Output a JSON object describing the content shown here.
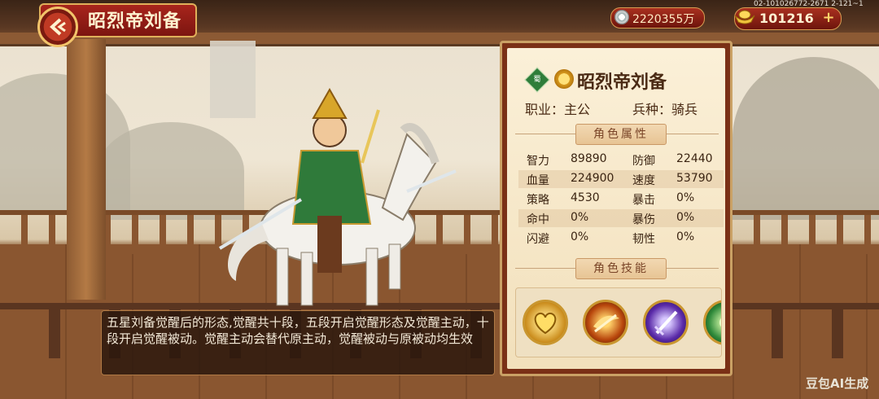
{
  "header": {
    "title": "昭烈帝刘备"
  },
  "currency": {
    "silver": "2220355万",
    "gold": "101216",
    "build_id": "02-101026772-2671 2-121~1"
  },
  "description": "五星刘备觉醒后的形态,觉醒共十段，五段开启觉醒形态及觉醒主动，十段开启觉醒被动。觉醒主动会替代原主动，觉醒被动与原被动均生效",
  "panel": {
    "faction": "蜀",
    "name": "昭烈帝刘备",
    "job_label": "职业：主公",
    "troop_label": "兵种：骑兵",
    "attr_title": "角色属性",
    "skill_title": "角色技能",
    "stats": [
      {
        "l1": "智力",
        "v1": "89890",
        "l2": "防御",
        "v2": "22440"
      },
      {
        "l1": "血量",
        "v1": "224900",
        "l2": "速度",
        "v2": "53790"
      },
      {
        "l1": "策略",
        "v1": "4530",
        "l2": "暴击",
        "v2": "0%"
      },
      {
        "l1": "命中",
        "v1": "0%",
        "l2": "暴伤",
        "v2": "0%"
      },
      {
        "l1": "闪避",
        "v1": "0%",
        "l2": "韧性",
        "v2": "0%"
      }
    ],
    "skills": [
      {
        "icon": "golden-heart-icon",
        "color": "#c98a1a"
      },
      {
        "icon": "flaming-sword-icon",
        "color": "#b8460c"
      },
      {
        "icon": "violet-blade-icon",
        "color": "#5a2aa8"
      },
      {
        "icon": "green-skill-icon",
        "color": "#2f8a3a"
      }
    ]
  },
  "watermark": "豆包AI生成"
}
